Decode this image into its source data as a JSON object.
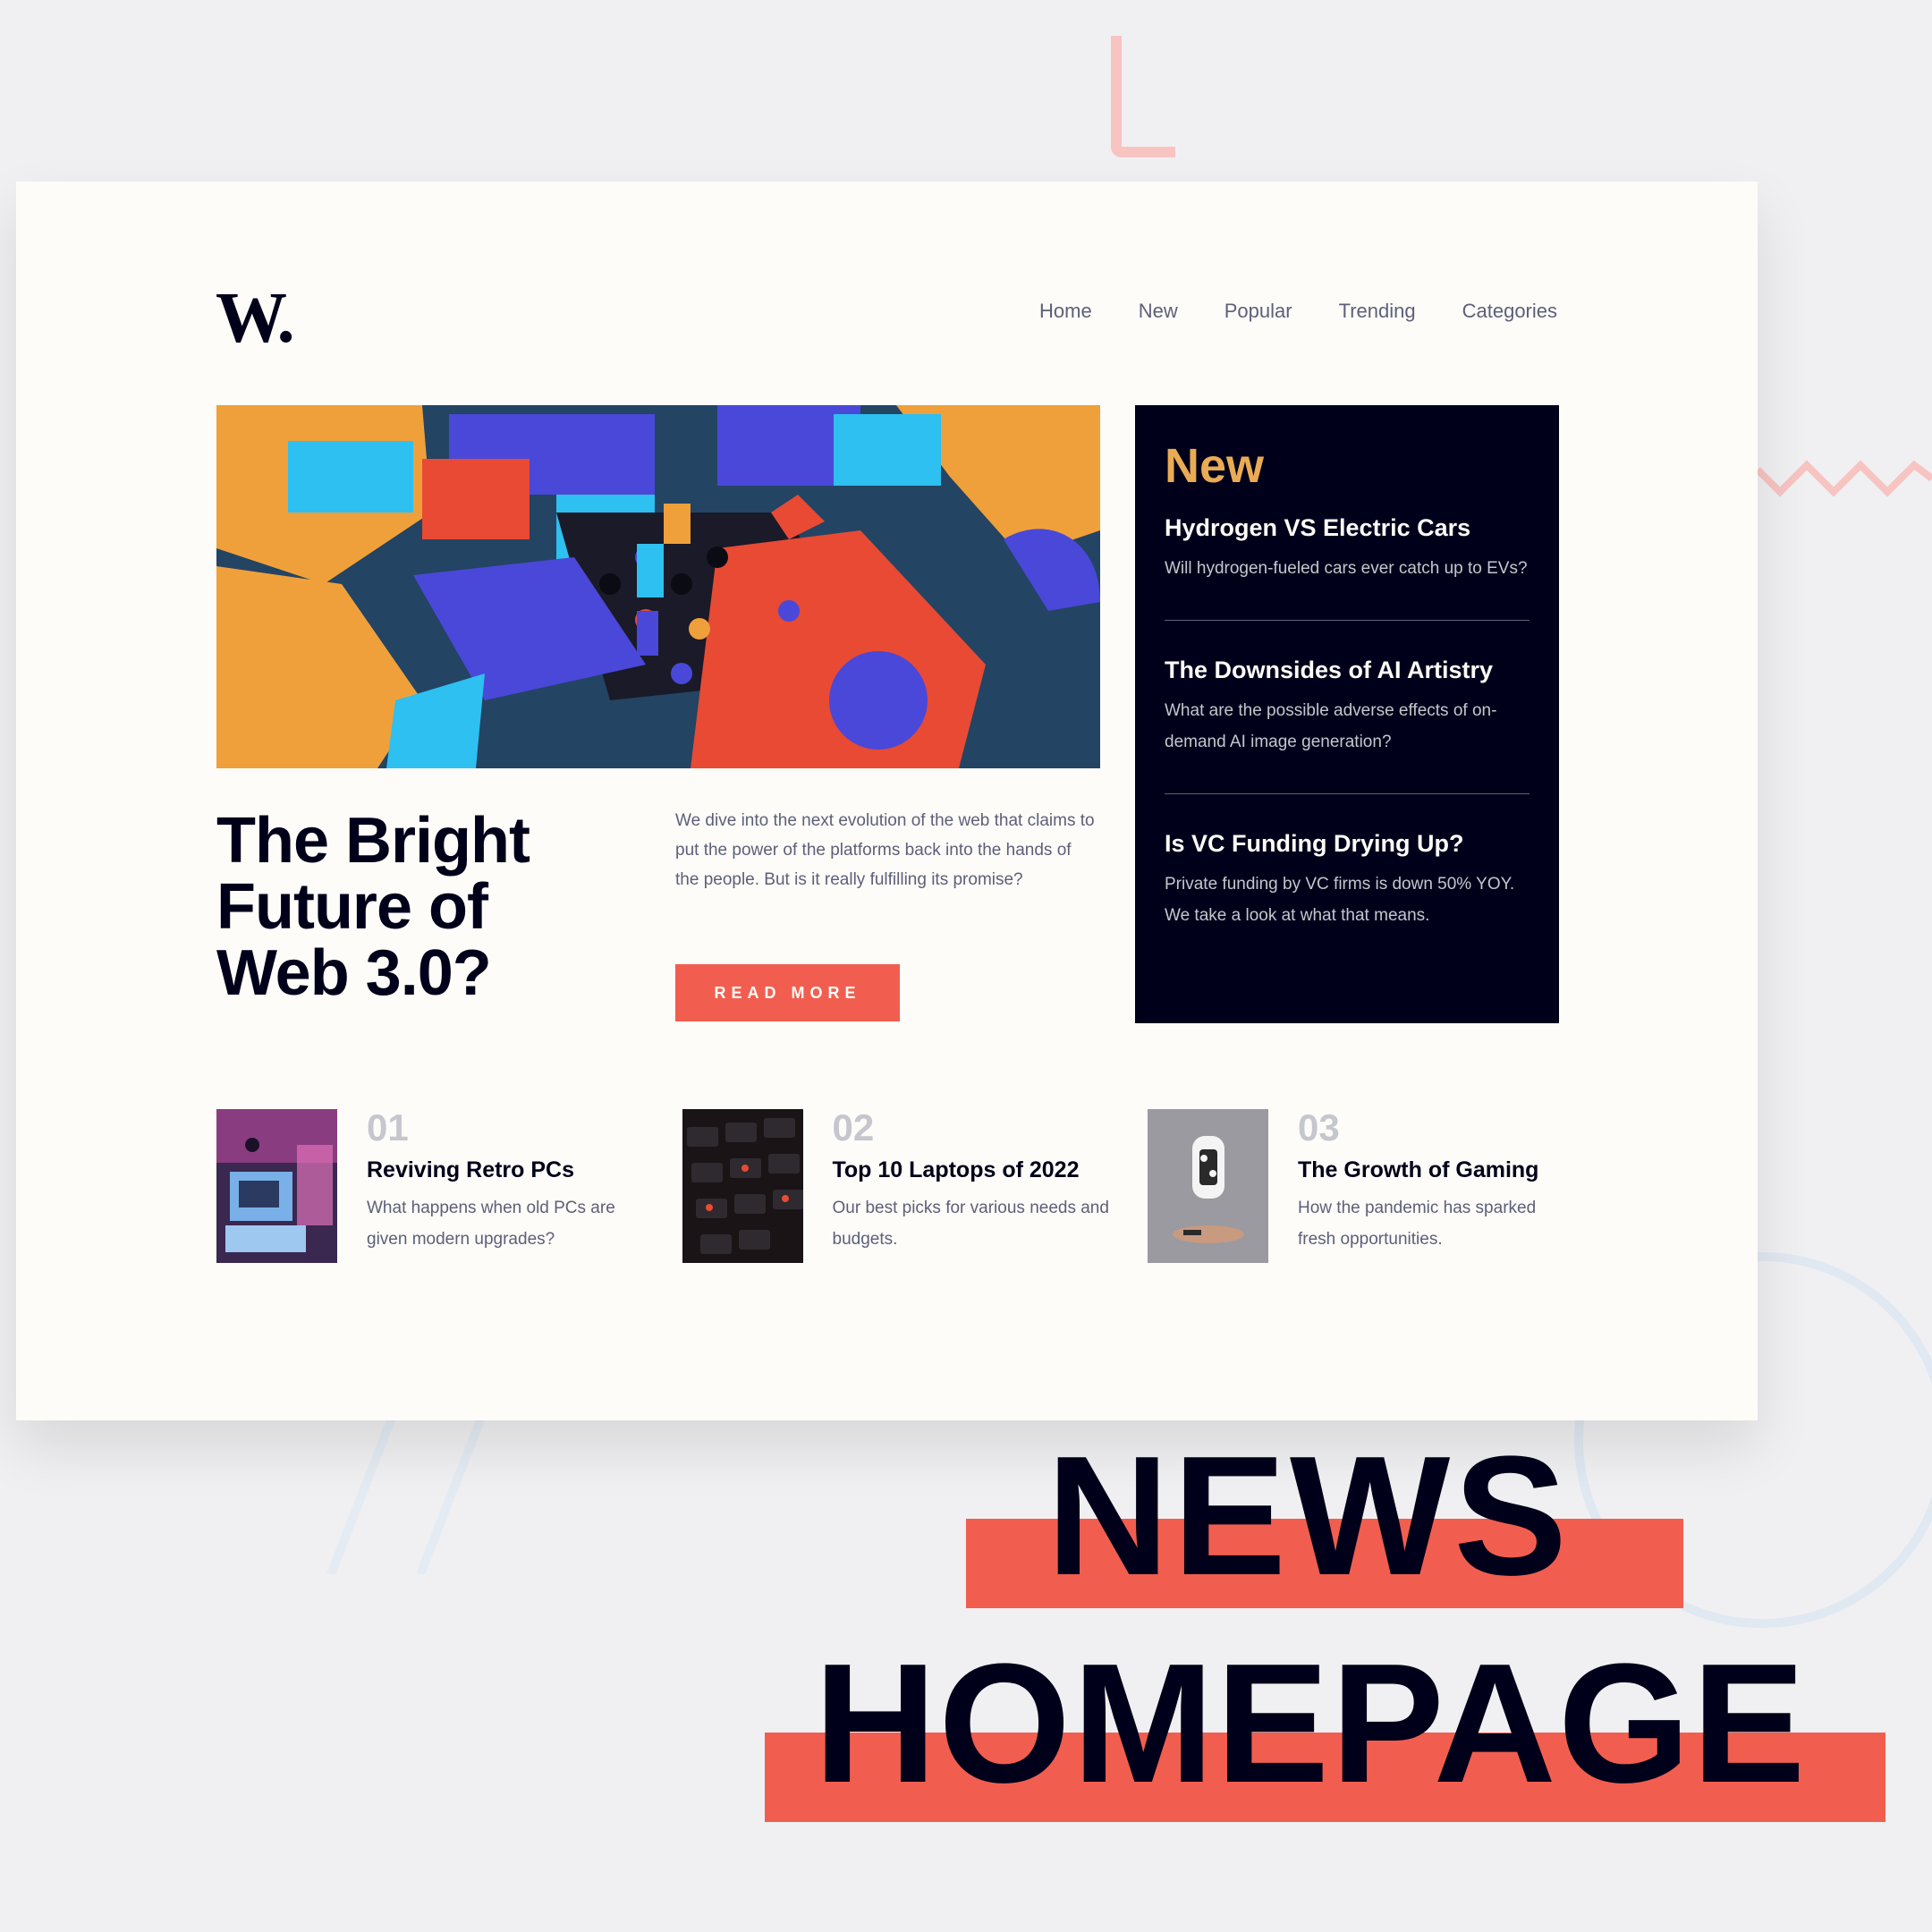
{
  "nav": {
    "logo": "W.",
    "items": [
      "Home",
      "New",
      "Popular",
      "Trending",
      "Categories"
    ]
  },
  "hero": {
    "title": "The Bright Future of Web 3.0?",
    "description": "We dive into the next evolution of the web that claims to put the power of the platforms back into the hands of the people. But is it really fulfilling its promise?",
    "button_label": "READ MORE"
  },
  "new_panel": {
    "heading": "New",
    "items": [
      {
        "title": "Hydrogen VS Electric Cars",
        "description": "Will hydrogen-fueled cars ever catch up to EVs?"
      },
      {
        "title": "The Downsides of AI Artistry",
        "description": "What are the possible adverse effects of on-demand AI image generation?"
      },
      {
        "title": "Is VC Funding Drying Up?",
        "description": "Private funding by VC firms is down 50% YOY. We take a look at what that means."
      }
    ]
  },
  "articles": [
    {
      "number": "01",
      "title": "Reviving Retro PCs",
      "description": "What happens when old PCs are given modern upgrades?"
    },
    {
      "number": "02",
      "title": "Top 10 Laptops of 2022",
      "description": "Our best picks for various needs and budgets."
    },
    {
      "number": "03",
      "title": "The Growth of Gaming",
      "description": "How the pandemic has sparked fresh opportunities."
    }
  ],
  "caption": {
    "line1": "NEWS",
    "line2": "HOMEPAGE"
  },
  "colors": {
    "background": "#f0f0f2",
    "card": "#fdfcf8",
    "dark": "#00001a",
    "accent_red": "#f15e50",
    "accent_orange": "#e9ab53",
    "grey_text": "#5d5f79",
    "light_grey": "#c5c6ce"
  }
}
